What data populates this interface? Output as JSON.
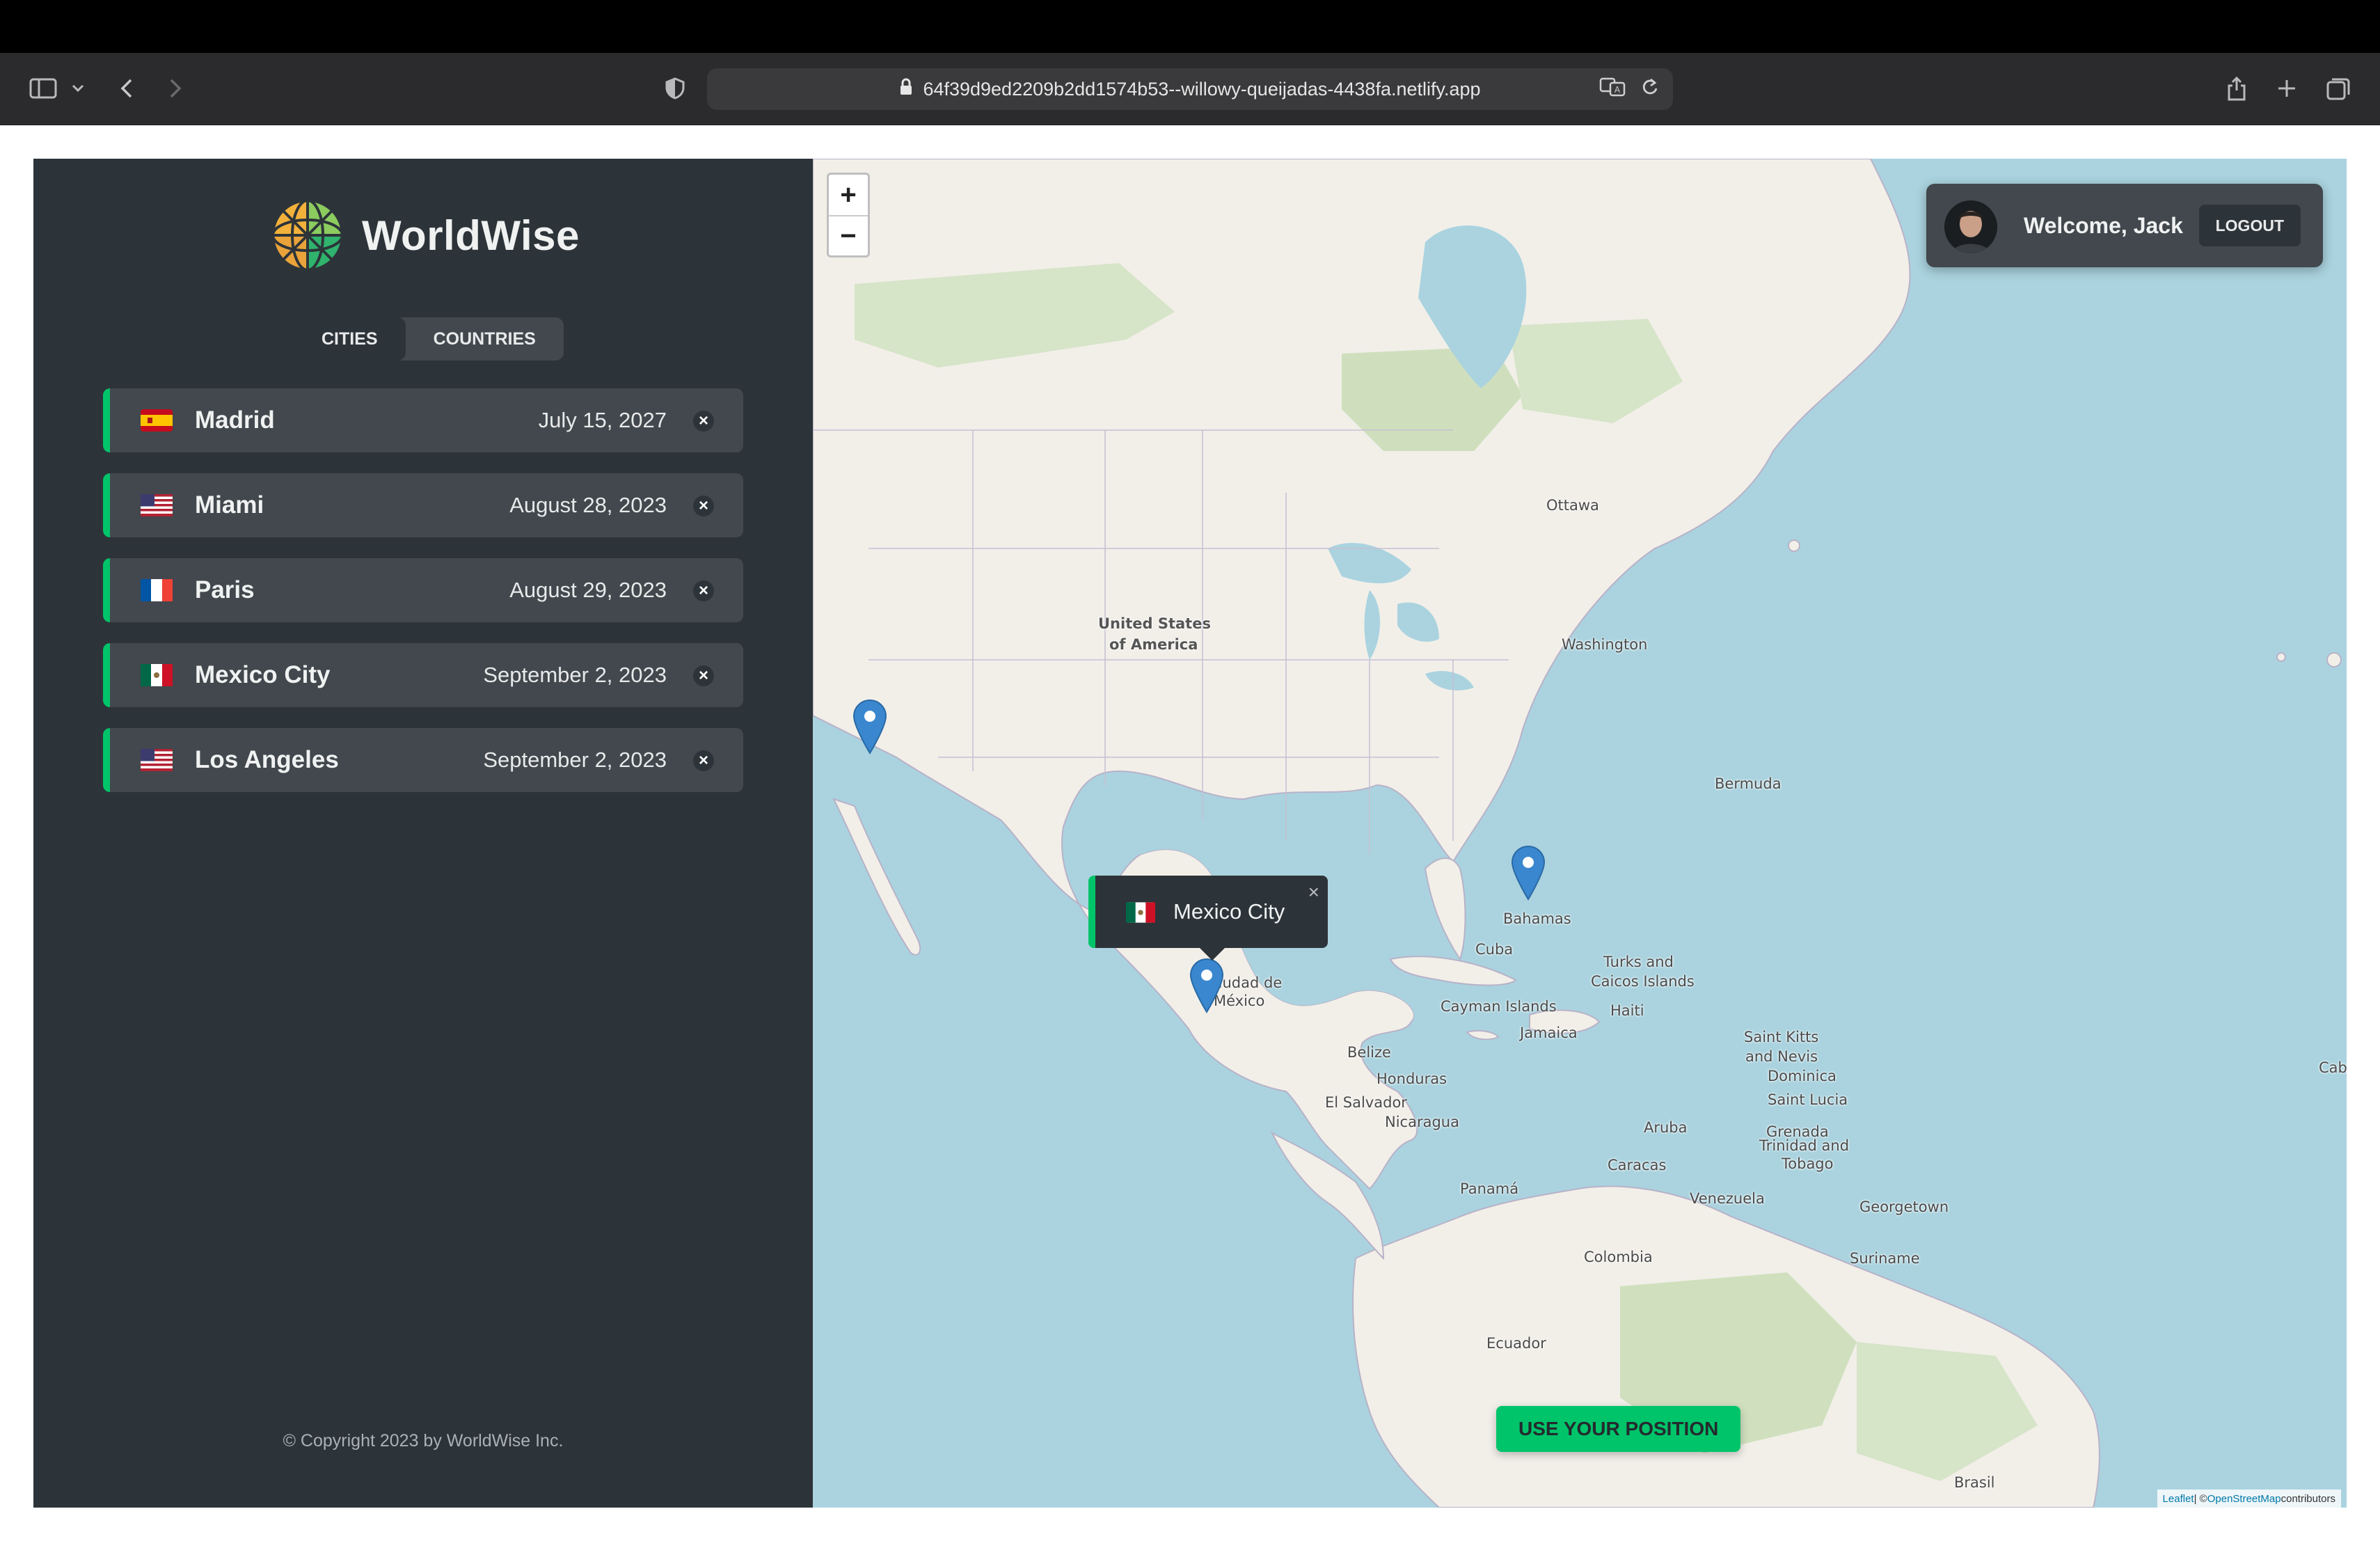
{
  "browser": {
    "url": "64f39d9ed2209b2dd1574b53--willowy-queijadas-4438fa.netlify.app"
  },
  "app": {
    "logo_text": "WorldWise",
    "tabs": [
      {
        "label": "CITIES",
        "active": true
      },
      {
        "label": "COUNTRIES",
        "active": false
      }
    ],
    "cities": [
      {
        "name": "Madrid",
        "date": "July 15, 2027",
        "flag": "spain-flag",
        "delete": "×"
      },
      {
        "name": "Miami",
        "date": "August 28, 2023",
        "flag": "usa-flag",
        "delete": "×"
      },
      {
        "name": "Paris",
        "date": "August 29, 2023",
        "flag": "france-flag",
        "delete": "×"
      },
      {
        "name": "Mexico City",
        "date": "September 2, 2023",
        "flag": "mexico-flag",
        "delete": "×"
      },
      {
        "name": "Los Angeles",
        "date": "September 2, 2023",
        "flag": "usa-flag",
        "delete": "×"
      }
    ],
    "copyright": "© Copyright 2023 by WorldWise Inc.",
    "accent_color": "#00c46a",
    "dark_bg": "#2d3439",
    "light_bg": "#42484d"
  },
  "map": {
    "zoom_in": "+",
    "zoom_out": "−",
    "user": {
      "welcome": "Welcome, Jack",
      "logout": "LOGOUT"
    },
    "popup": {
      "city": "Mexico City",
      "close": "×"
    },
    "use_position": "USE YOUR POSITION",
    "attribution": {
      "leaflet": "Leaflet",
      "sep": " | © ",
      "osm": "OpenStreetMap",
      "contributors": " contributors"
    },
    "labels": {
      "ottawa": "Ottawa",
      "usa_1": "United States",
      "usa_2": "of America",
      "washington": "Washington",
      "bermuda": "Bermuda",
      "bahamas": "Bahamas",
      "cuba": "Cuba",
      "turks_1": "Turks and",
      "turks_2": "Caicos Islands",
      "cayman": "Cayman Islands",
      "haiti": "Haiti",
      "jamaica": "Jamaica",
      "ciudad_1": "Ciudad de",
      "ciudad_2": "México",
      "belize": "Belize",
      "honduras": "Honduras",
      "el_salvador": "El Salvador",
      "nicaragua": "Nicaragua",
      "saint_kitts_1": "Saint Kitts",
      "saint_kitts_2": "and Nevis",
      "dominica": "Dominica",
      "saint_lucia": "Saint Lucia",
      "grenada": "Grenada",
      "trinidad_1": "Trinidad and",
      "trinidad_2": "Tobago",
      "aruba": "Aruba",
      "caracas": "Caracas",
      "venezuela": "Venezuela",
      "georgetown": "Georgetown",
      "suriname": "Suriname",
      "panama": "Panamá",
      "colombia": "Colombia",
      "ecuador": "Ecuador",
      "brasil": "Brasil",
      "cab": "Cab"
    }
  }
}
